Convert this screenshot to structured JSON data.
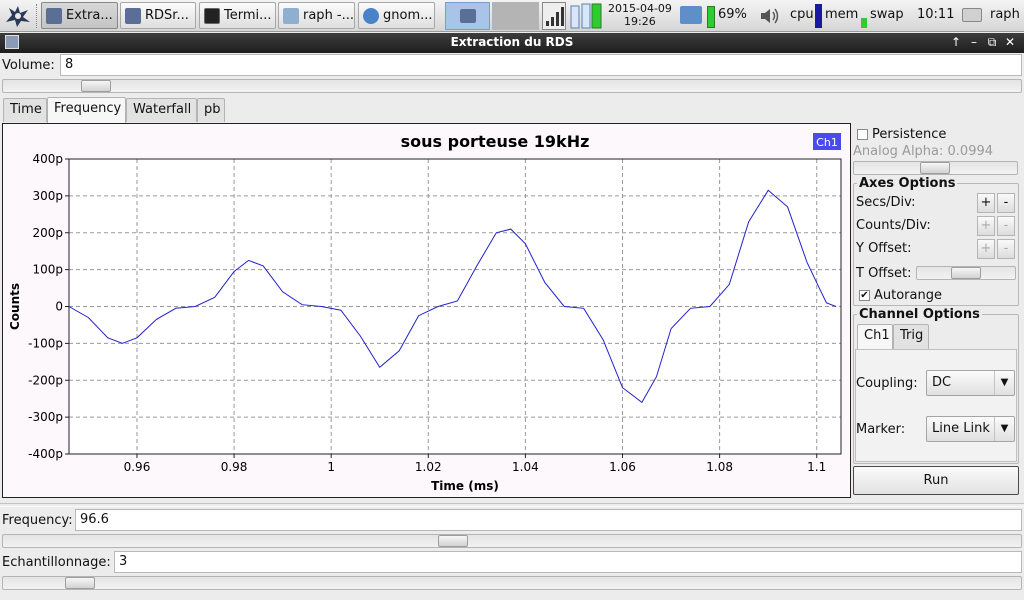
{
  "taskbar": {
    "tasks": [
      {
        "label": "Extra...",
        "icon": "app-icon"
      },
      {
        "label": "RDSr...",
        "icon": "app-icon"
      },
      {
        "label": "Termi...",
        "icon": "terminal-icon"
      },
      {
        "label": "raph -...",
        "icon": "folder-icon"
      },
      {
        "label": "gnom...",
        "icon": "browser-icon"
      }
    ],
    "date": "2015-04-09",
    "time_small": "19:26",
    "battery": "69%",
    "cpu_label": "cpu",
    "mem_label": "mem",
    "swap_label": "swap",
    "clock": "10:11",
    "user": "raph"
  },
  "window": {
    "title": "Extraction du RDS"
  },
  "volume": {
    "label": "Volume:",
    "value": "8"
  },
  "tabs": [
    "Time",
    "Frequency",
    "Waterfall",
    "pb"
  ],
  "selected_tab": "Frequency",
  "chart_data": {
    "type": "line",
    "title": "sous porteuse 19kHz",
    "xlabel": "Time (ms)",
    "ylabel": "Counts",
    "xlim": [
      0.946,
      1.105
    ],
    "ylim": [
      -400,
      400
    ],
    "x_ticks": [
      "0.96",
      "0.98",
      "1",
      "1.02",
      "1.04",
      "1.06",
      "1.08",
      "1.1"
    ],
    "x_tick_values": [
      0.96,
      0.98,
      1.0,
      1.02,
      1.04,
      1.06,
      1.08,
      1.1
    ],
    "y_ticks": [
      "400p",
      "300p",
      "200p",
      "100p",
      "0",
      "-100p",
      "-200p",
      "-300p",
      "-400p"
    ],
    "y_tick_values": [
      400,
      300,
      200,
      100,
      0,
      -100,
      -200,
      -300,
      -400
    ],
    "grid": true,
    "legend": "top-right",
    "series": [
      {
        "name": "Ch1",
        "color": "#2222cc",
        "x": [
          0.946,
          0.95,
          0.954,
          0.957,
          0.96,
          0.964,
          0.968,
          0.972,
          0.976,
          0.98,
          0.983,
          0.986,
          0.99,
          0.994,
          0.998,
          1.002,
          1.006,
          1.01,
          1.014,
          1.018,
          1.022,
          1.026,
          1.03,
          1.034,
          1.037,
          1.04,
          1.044,
          1.048,
          1.052,
          1.056,
          1.06,
          1.064,
          1.067,
          1.07,
          1.074,
          1.078,
          1.082,
          1.086,
          1.09,
          1.094,
          1.098,
          1.102,
          1.104
        ],
        "y": [
          0,
          -30,
          -85,
          -100,
          -85,
          -35,
          -5,
          0,
          25,
          95,
          125,
          110,
          40,
          5,
          0,
          -10,
          -80,
          -165,
          -120,
          -25,
          0,
          15,
          110,
          200,
          210,
          170,
          65,
          0,
          -5,
          -90,
          -220,
          -260,
          -190,
          -60,
          -5,
          0,
          60,
          230,
          315,
          270,
          120,
          10,
          0
        ]
      }
    ]
  },
  "side": {
    "persistence_label": "Persistence",
    "analog_alpha": "Analog Alpha: 0.0994",
    "axes_title": "Axes Options",
    "secs_div": "Secs/Div:",
    "counts_div": "Counts/Div:",
    "y_offset": "Y Offset:",
    "t_offset": "T Offset:",
    "autorange": "Autorange",
    "plus": "+",
    "minus": "-",
    "channel_title": "Channel Options",
    "channel_tabs": [
      "Ch1",
      "Trig"
    ],
    "coupling_label": "Coupling:",
    "coupling_value": "DC",
    "marker_label": "Marker:",
    "marker_value": "Line Link",
    "run": "Run"
  },
  "frequency": {
    "label": "Frequency:",
    "value": "96.6"
  },
  "echantillonnage": {
    "label": "Echantillonnage:",
    "value": "3"
  }
}
